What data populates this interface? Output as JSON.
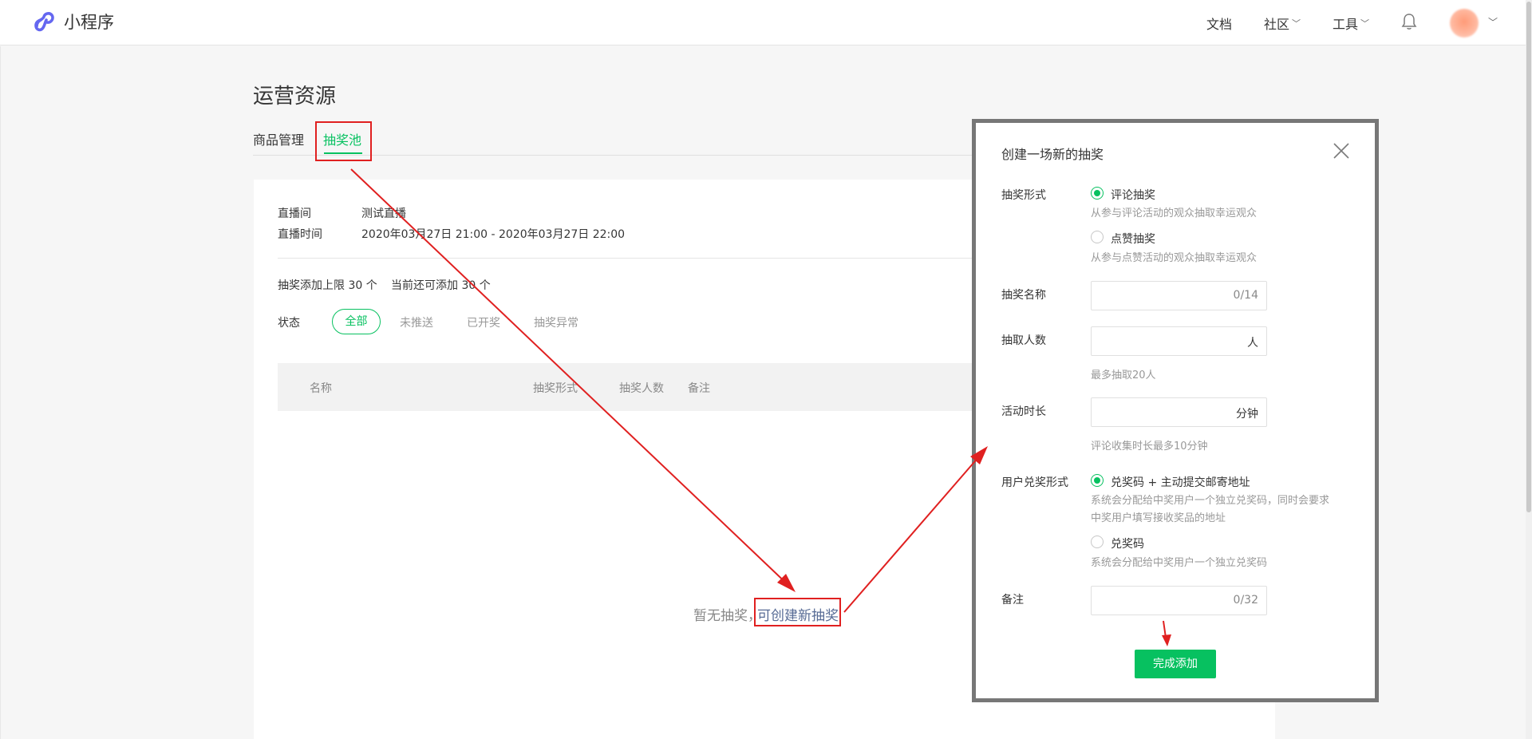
{
  "nav": {
    "brand": "小程序",
    "items": [
      {
        "label": "文档",
        "has_dropdown": false
      },
      {
        "label": "社区",
        "has_dropdown": true
      },
      {
        "label": "工具",
        "has_dropdown": true
      }
    ],
    "dropdown_chevron": "﹀"
  },
  "page": {
    "title": "运营资源",
    "tabs": [
      {
        "label": "商品管理",
        "active": false
      },
      {
        "label": "抽奖池",
        "active": true
      }
    ]
  },
  "live_info": {
    "room_label": "直播间",
    "room_value": "测试直播",
    "time_label": "直播时间",
    "time_value": "2020年03月27日 21:00 - 2020年03月27日 22:00"
  },
  "limits": {
    "max_text": "抽奖添加上限 30 个",
    "remaining_text": "当前还可添加 30 个"
  },
  "filters": {
    "label": "状态",
    "options": [
      "全部",
      "未推送",
      "已开奖",
      "抽奖异常"
    ],
    "selected": "全部"
  },
  "table": {
    "columns": [
      "名称",
      "抽奖形式",
      "抽奖人数",
      "备注"
    ]
  },
  "empty_state": {
    "text": "暂无抽奖，",
    "link": "可创建新抽奖"
  },
  "modal": {
    "title": "创建一场新的抽奖",
    "form": {
      "type_label": "抽奖形式",
      "type_options": [
        {
          "label": "评论抽奖",
          "hint": "从参与评论活动的观众抽取幸运观众",
          "checked": true
        },
        {
          "label": "点赞抽奖",
          "hint": "从参与点赞活动的观众抽取幸运观众",
          "checked": false
        }
      ],
      "name_label": "抽奖名称",
      "name_counter": "0/14",
      "count_label": "抽取人数",
      "count_suffix": "人",
      "count_hint": "最多抽取20人",
      "duration_label": "活动时长",
      "duration_suffix": "分钟",
      "duration_hint": "评论收集时长最多10分钟",
      "redeem_label": "用户兑奖形式",
      "redeem_options": [
        {
          "label": "兑奖码 + 主动提交邮寄地址",
          "hint_line1": "系统会分配给中奖用户一个独立兑奖码，同时会要求",
          "hint_line2": "中奖用户填写接收奖品的地址",
          "checked": true
        },
        {
          "label": "兑奖码",
          "hint_line1": "系统会分配给中奖用户一个独立兑奖码",
          "checked": false
        }
      ],
      "remark_label": "备注",
      "remark_counter": "0/32"
    },
    "submit_label": "完成添加"
  },
  "colors": {
    "brand_green": "#07c160",
    "link_blue": "#576b95",
    "annotation_red": "#e02020",
    "logo_purple": "#6467f0"
  },
  "icons": {
    "logo": "miniprogram-logo-icon",
    "bell": "bell-icon",
    "close": "close-icon"
  }
}
